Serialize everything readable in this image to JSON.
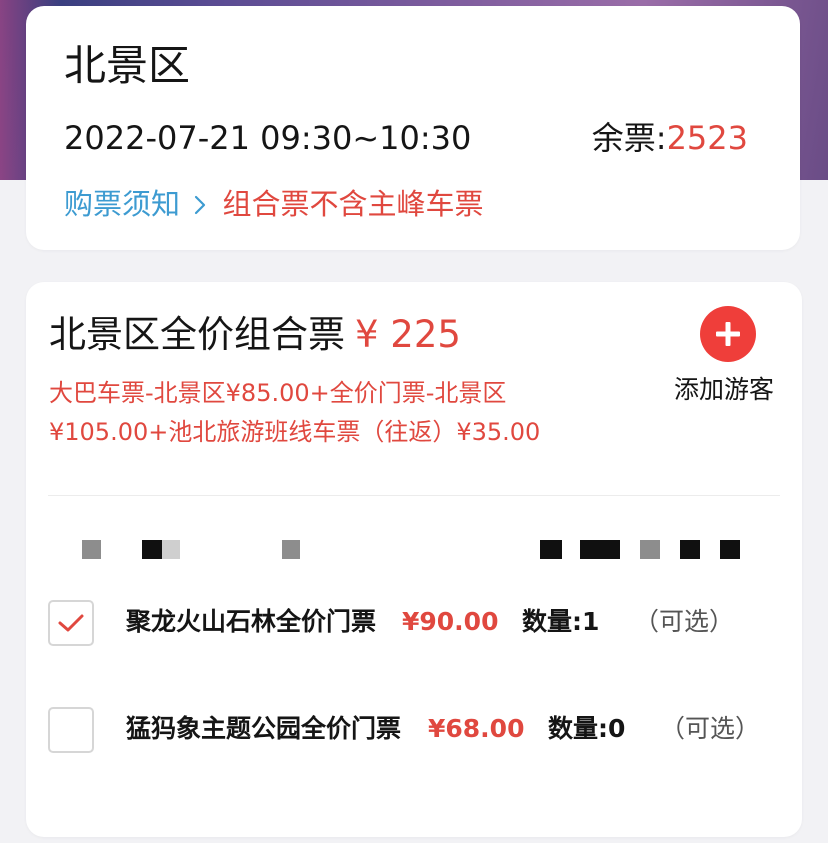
{
  "header": {
    "area_name": "北景区",
    "time_range": "2022-07-21 09:30~10:30",
    "remaining_label": "余票:",
    "remaining_count": "2523",
    "notice_link": "购票须知",
    "notice_chevron": "chevron-right-icon",
    "notice_warning": "组合票不含主峰车票"
  },
  "package": {
    "title": "北景区全价组合票",
    "price": "¥ 225",
    "description": "大巴车票-北景区¥85.00+全价门票-北景区¥105.00+池北旅游班线车票（往返）¥35.00",
    "add_icon": "plus-circle-icon",
    "add_label": "添加游客"
  },
  "options": [
    {
      "name": "聚龙火山石林全价门票",
      "price": "¥90.00",
      "quantity": "数量:1",
      "optional": "（可选）",
      "checked": true
    },
    {
      "name": "猛犸象主题公园全价门票",
      "price": "¥68.00",
      "quantity": "数量:0",
      "optional": "（可选）",
      "checked": false
    }
  ],
  "colors": {
    "accent_red": "#e0483f",
    "link_blue": "#3d9bd1",
    "add_button": "#ef3e3a"
  }
}
